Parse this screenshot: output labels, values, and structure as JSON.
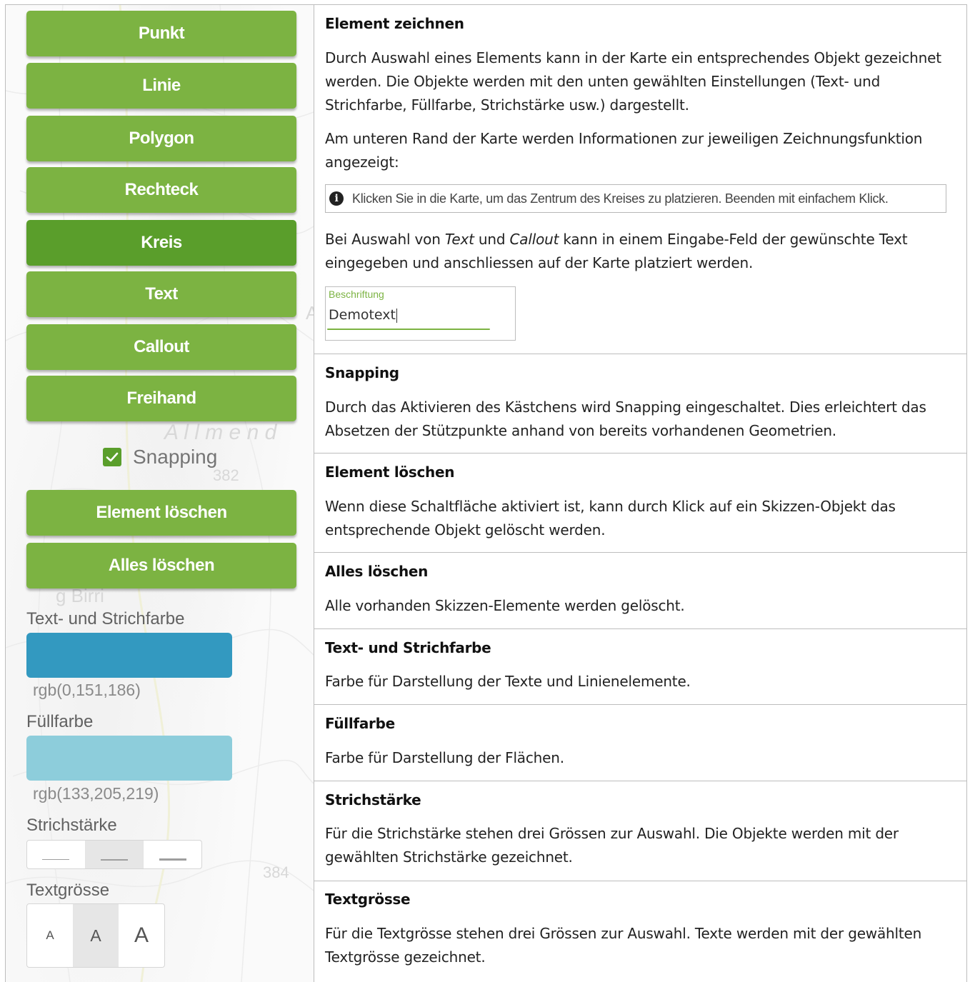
{
  "tool_panel": {
    "buttons": {
      "punkt": "Punkt",
      "linie": "Linie",
      "polygon": "Polygon",
      "rechteck": "Rechteck",
      "kreis": "Kreis",
      "text": "Text",
      "callout": "Callout",
      "freihand": "Freihand"
    },
    "active_tool": "Kreis",
    "snapping": {
      "label": "Snapping",
      "checked": true
    },
    "delete_element": "Element löschen",
    "delete_all": "Alles löschen",
    "stroke_color": {
      "label": "Text- und Strichfarbe",
      "value": "rgb(0,151,186)",
      "hex": "#3399c0"
    },
    "fill_color": {
      "label": "Füllfarbe",
      "value": "rgb(133,205,219)",
      "hex": "#8dcddb"
    },
    "stroke_width": {
      "label": "Strichstärke",
      "options": [
        "thin",
        "medium",
        "thick"
      ],
      "selected": "medium"
    },
    "text_size": {
      "label": "Textgrösse",
      "options": [
        "A",
        "A",
        "A"
      ],
      "selected_index": 1
    },
    "map_labels": {
      "place_1": "Aristau",
      "place_2": "A l l m e n d",
      "height_382": "382",
      "height_384": "384",
      "place_3": "g Birri"
    },
    "colors": {
      "button_green": "#7cb342",
      "button_active": "#5a9e2b"
    }
  },
  "docs": {
    "element_zeichnen": {
      "heading": "Element zeichnen",
      "para1": "Durch Auswahl eines Elements kann in der Karte ein entsprechendes Objekt gezeichnet werden. Die Objekte werden mit den unten gewählten Einstellungen (Text- und Strichfarbe, Füllfarbe, Strichstärke usw.) dargestellt.",
      "para2": "Am unteren Rand der Karte werden Informationen zur jeweiligen Zeichnungsfunktion angezeigt:",
      "info_text": "Klicken Sie in die Karte, um das Zentrum des Kreises zu platzieren. Beenden mit einfachem Klick.",
      "para3_a": "Bei Auswahl von ",
      "para3_text": "Text",
      "para3_b": " und ",
      "para3_callout": "Callout",
      "para3_c": " kann in einem Eingabe-Feld der gewünschte Text eingegeben und anschliessen auf der Karte platziert werden.",
      "demo_field_label": "Beschriftung",
      "demo_field_value": "Demotext"
    },
    "snapping": {
      "heading": "Snapping",
      "text": "Durch das Aktivieren des Kästchens wird Snapping eingeschaltet. Dies erleichtert das Absetzen der Stützpunkte anhand von bereits vorhandenen Geometrien."
    },
    "element_loeschen": {
      "heading": "Element löschen",
      "text": "Wenn diese Schaltfläche aktiviert ist, kann durch Klick auf ein Skizzen-Objekt das entsprechende Objekt gelöscht werden."
    },
    "alles_loeschen": {
      "heading": "Alles löschen",
      "text": "Alle vorhanden Skizzen-Elemente werden gelöscht."
    },
    "strichfarbe": {
      "heading": "Text- und Strichfarbe",
      "text": "Farbe für Darstellung der Texte und Linienelemente."
    },
    "fuellfarbe": {
      "heading": "Füllfarbe",
      "text": "Farbe für Darstellung der Flächen."
    },
    "strichstaerke": {
      "heading": "Strichstärke",
      "text": "Für die Strichstärke stehen drei Grössen zur Auswahl. Die Objekte werden mit der gewählten Strichstärke gezeichnet."
    },
    "textgroesse": {
      "heading": "Textgrösse",
      "text": "Für die Textgrösse stehen drei Grössen zur Auswahl. Texte werden mit der gewählten Textgrösse gezeichnet."
    }
  }
}
